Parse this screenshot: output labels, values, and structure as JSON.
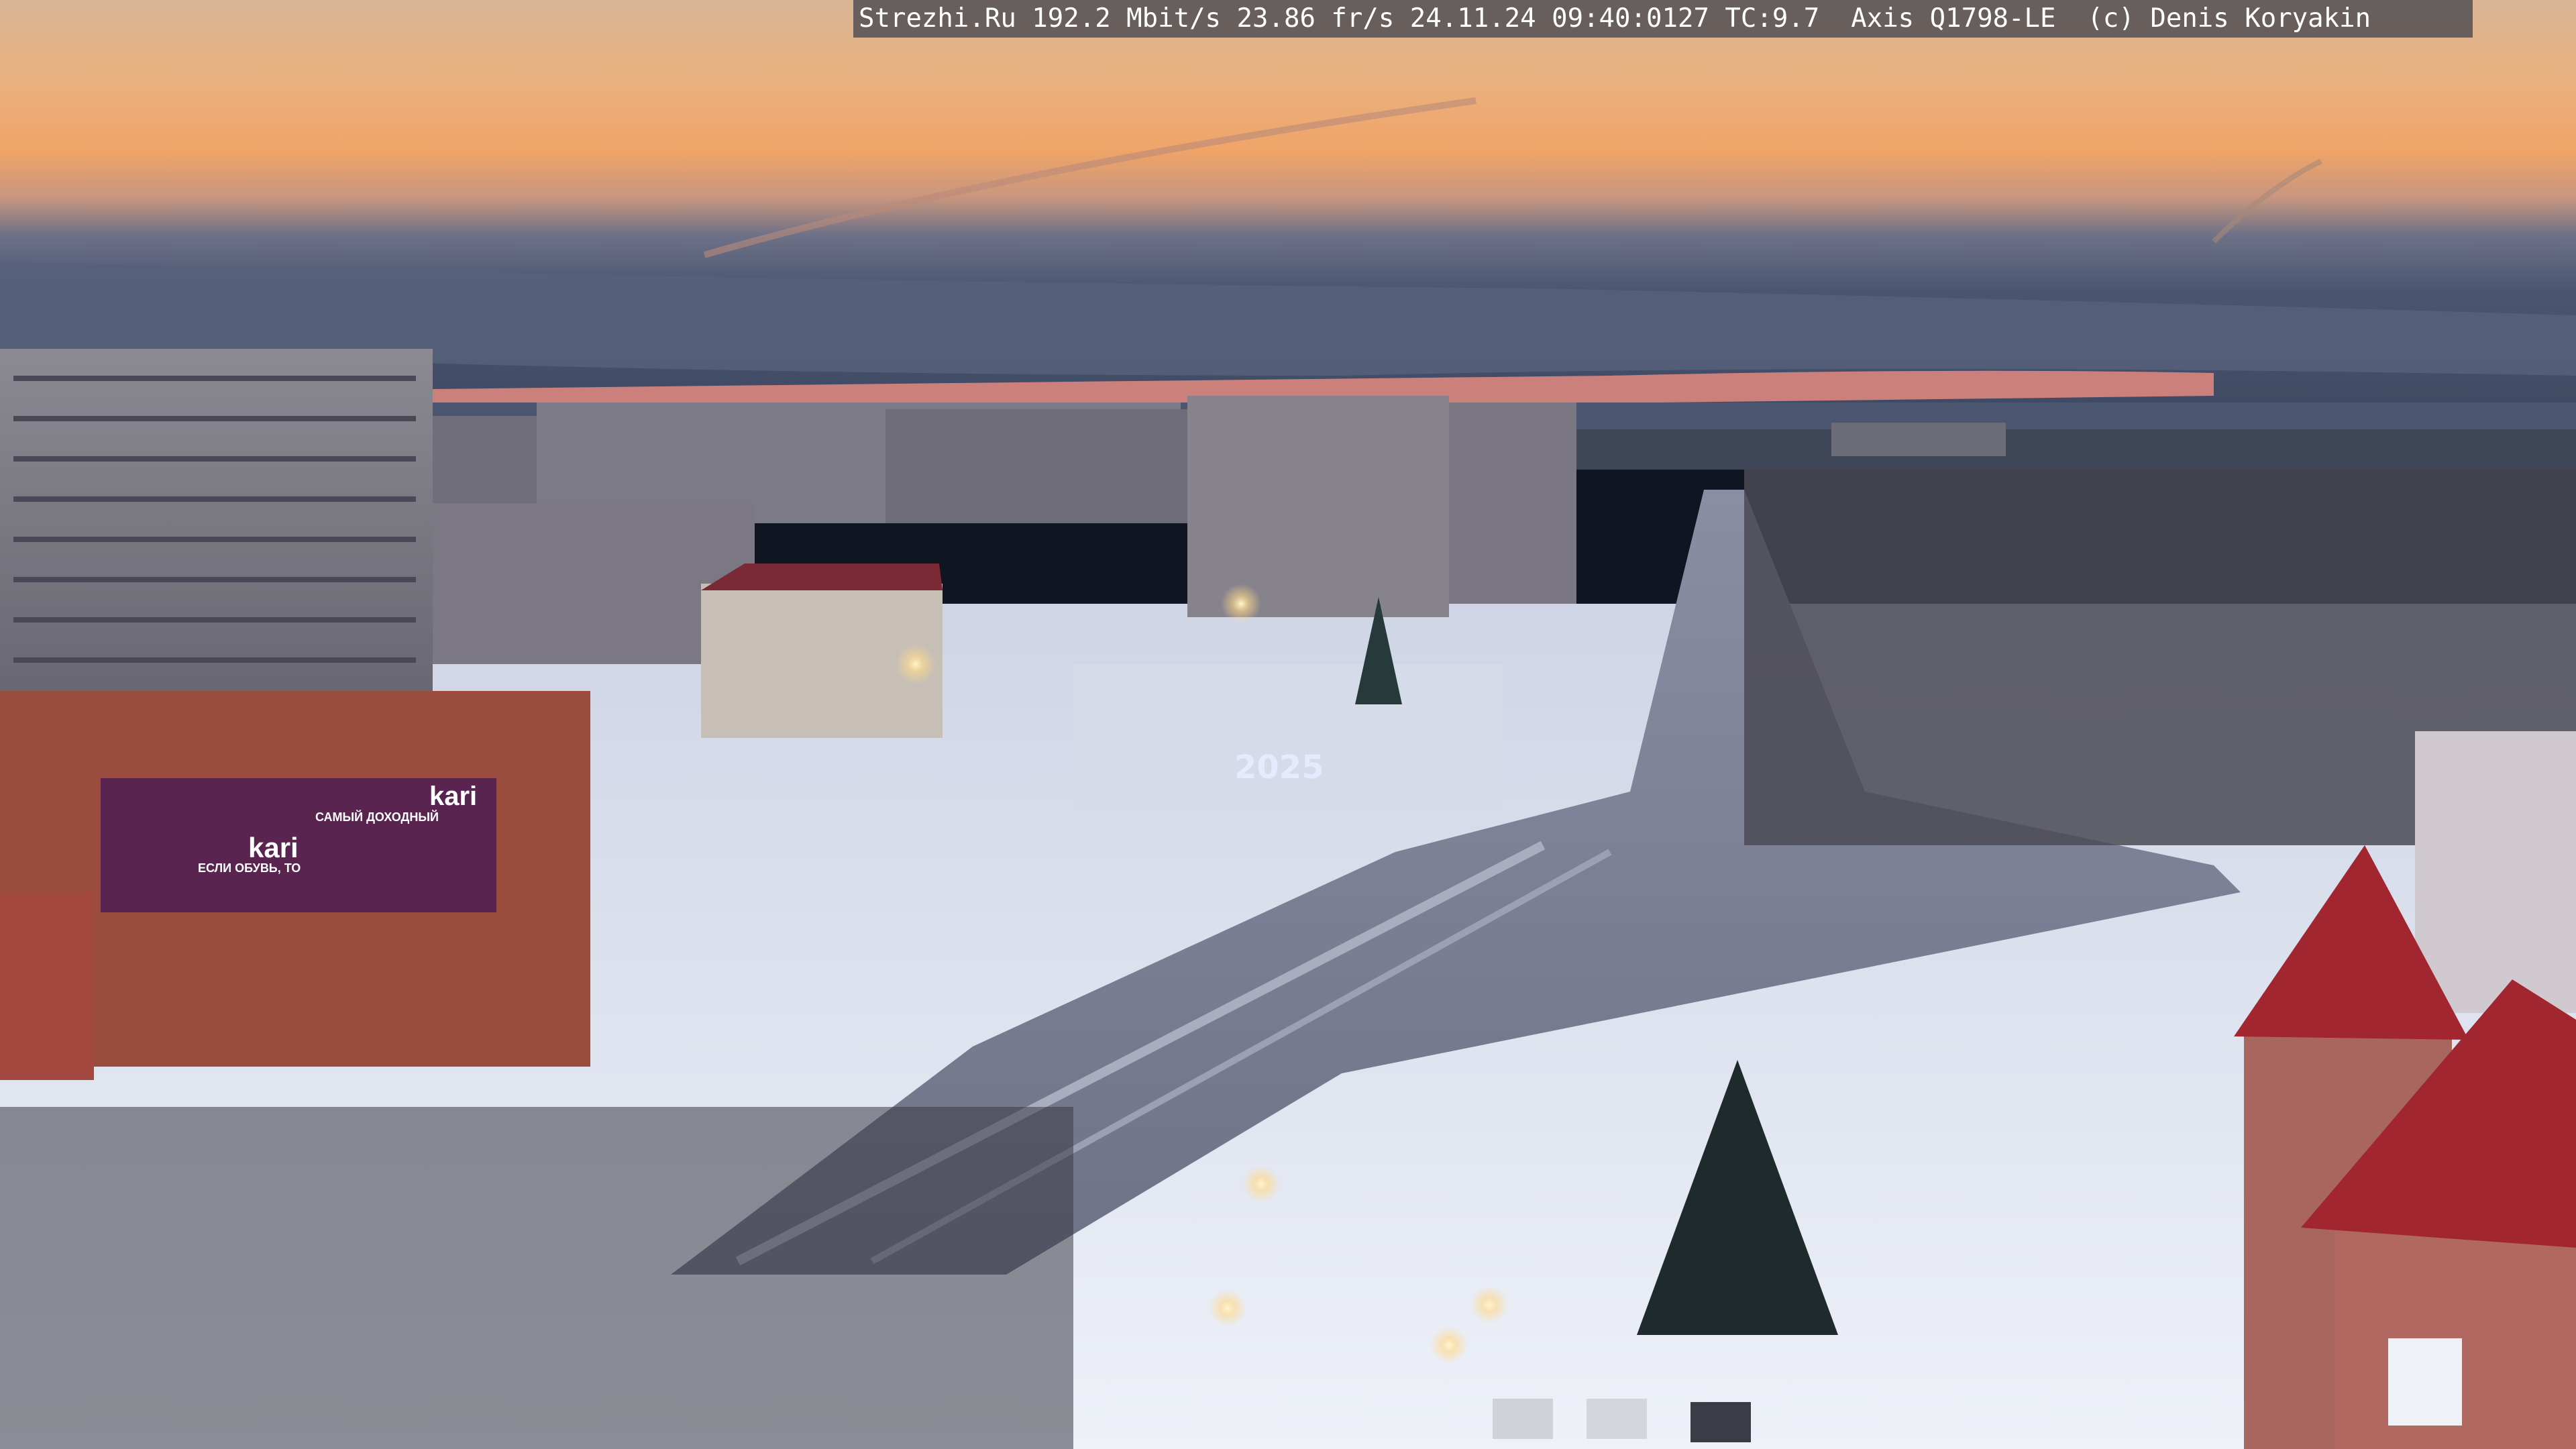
{
  "overlay": {
    "caption": "Strezhi.Ru 192.2 Mbit/s 23.86 fr/s 24.11.24 09:40:0127 TC:9.7  Axis Q1798-LE  (c) Denis Koryakin"
  },
  "signage": {
    "store_brand": "kari",
    "store_brand_2": "kari",
    "store_slogan": "САМЫЙ ДОХОДНЫЙ",
    "banner_text": "ЕСЛИ ОБУВЬ, ТО",
    "holiday_number": "2025"
  },
  "colors": {
    "sky_top": "#e8b27a",
    "sky_glow": "#f4a05e",
    "cloud_band": "#47526a",
    "snow": "#dfe4f0",
    "roof_red": "#a12630",
    "store_purple": "#5a2450"
  }
}
